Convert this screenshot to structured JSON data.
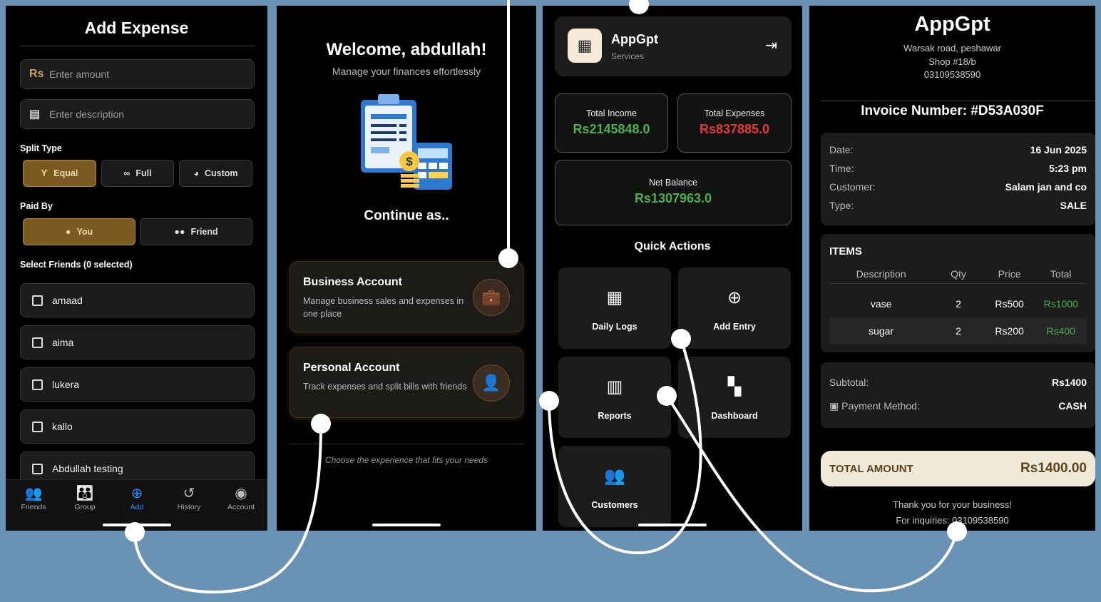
{
  "add_expense": {
    "title": "Add Expense",
    "amount": {
      "prefix": "Rs",
      "placeholder": "Enter amount"
    },
    "description": {
      "placeholder": "Enter description"
    },
    "split_type_label": "Split Type",
    "split_options": [
      "Equal",
      "Full",
      "Custom"
    ],
    "split_selected": "Equal",
    "paid_by_label": "Paid By",
    "paid_options": [
      "You",
      "Friend"
    ],
    "paid_selected": "You",
    "select_friends_label": "Select Friends (0 selected)",
    "friends": [
      "amaad",
      "aima",
      "lukera",
      "kallo",
      "Abdullah testing"
    ],
    "tabs": [
      "Friends",
      "Group",
      "Add",
      "History",
      "Account"
    ],
    "active_tab": "Add"
  },
  "welcome": {
    "heading": "Welcome, abdullah!",
    "subtitle": "Manage your finances effortlessly",
    "continue_label": "Continue as..",
    "accounts": [
      {
        "title": "Business Account",
        "desc": "Manage business sales and expenses in one place",
        "icon": "briefcase-icon"
      },
      {
        "title": "Personal Account",
        "desc": "Track expenses and split bills with friends",
        "icon": "person-icon"
      }
    ],
    "footer": "Choose the experience that fits your needs"
  },
  "dashboard": {
    "business_name": "AppGpt",
    "business_type": "Services",
    "total_income_label": "Total Income",
    "total_income": "Rs2145848.0",
    "total_expenses_label": "Total Expenses",
    "total_expenses": "Rs837885.0",
    "net_balance_label": "Net Balance",
    "net_balance": "Rs1307963.0",
    "quick_actions_label": "Quick Actions",
    "actions": [
      "Daily Logs",
      "Add Entry",
      "Reports",
      "Dashboard",
      "Customers"
    ],
    "colors": {
      "income": "#4caf50",
      "expense": "#e53935"
    }
  },
  "invoice": {
    "app_name": "AppGpt",
    "address_lines": [
      "Warsak road, peshawar",
      "Shop #18/b",
      "03109538590"
    ],
    "invoice_number_label": "Invoice Number: #D53A030F",
    "date_label": "Date:",
    "date": "16 Jun 2025",
    "time_label": "Time:",
    "time": "5:23 pm",
    "customer_label": "Customer:",
    "customer": "Salam jan and co",
    "type_label": "Type:",
    "type": "SALE",
    "items_label": "ITEMS",
    "columns": [
      "Description",
      "Qty",
      "Price",
      "Total"
    ],
    "items": [
      {
        "description": "vase",
        "qty": "2",
        "price": "Rs500",
        "total": "Rs1000"
      },
      {
        "description": "sugar",
        "qty": "2",
        "price": "Rs200",
        "total": "Rs400"
      }
    ],
    "subtotal_label": "Subtotal:",
    "subtotal": "Rs1400",
    "payment_label": "Payment Method:",
    "payment": "CASH",
    "total_label": "TOTAL AMOUNT",
    "total": "Rs1400.00",
    "thanks": "Thank you for your business!",
    "inquiries": "For inquiries: 03109538590"
  }
}
